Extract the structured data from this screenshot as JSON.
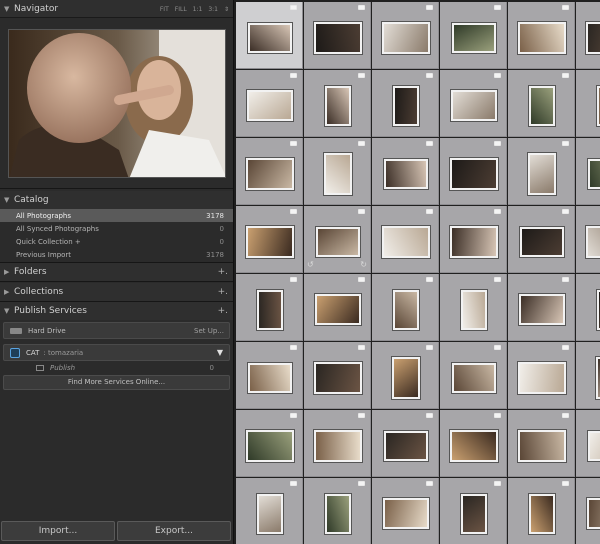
{
  "navigator": {
    "title": "Navigator",
    "zoom_options": [
      "FIT",
      "FILL",
      "1:1",
      "3:1"
    ]
  },
  "catalog": {
    "title": "Catalog",
    "items": [
      {
        "label": "All Photographs",
        "count": "3178"
      },
      {
        "label": "All Synced Photographs",
        "count": "0"
      },
      {
        "label": "Quick Collection +",
        "count": "0"
      },
      {
        "label": "Previous Import",
        "count": "3178"
      }
    ]
  },
  "folders": {
    "title": "Folders"
  },
  "collections": {
    "title": "Collections"
  },
  "publish_services": {
    "title": "Publish Services",
    "hard_drive": {
      "label": "Hard Drive",
      "action": "Set Up..."
    },
    "service": {
      "name": "CAT",
      "user": ": tomazaria"
    },
    "publish": {
      "label": "Publish",
      "count": "0"
    },
    "find_more": "Find More Services Online..."
  },
  "buttons": {
    "import": "Import...",
    "export": "Export..."
  },
  "colors": {
    "selected_row": "#5a5a5a",
    "grid_cell": "#a7a6a9",
    "accent": "#5aa3e0"
  }
}
